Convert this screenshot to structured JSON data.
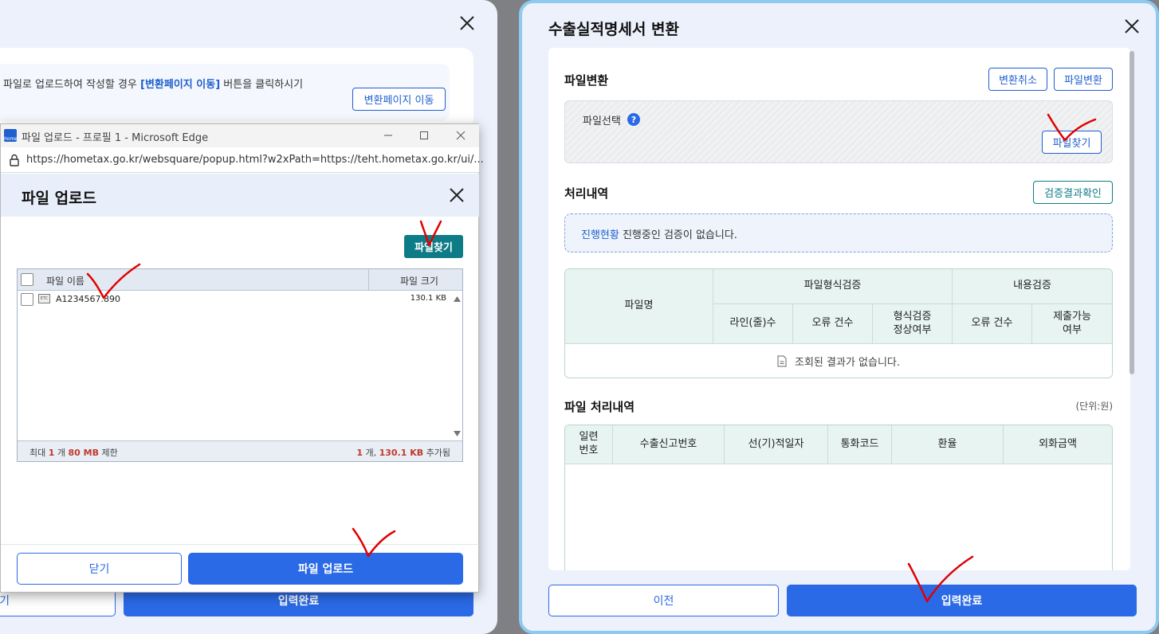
{
  "left_modal": {
    "info_text_prefix": "파일로 업로드하여 작성할 경우 ",
    "info_text_link": "[변환페이지 이동]",
    "info_text_suffix": " 버튼을 클릭하시기",
    "move_button": "변환페이지 이동",
    "prev_button": "기",
    "done_button": "입력완료"
  },
  "edge_window": {
    "title": "파일 업로드 - 프로필 1 - Microsoft Edge",
    "favicon_text": "Home",
    "url": "https://hometax.go.kr/websquare/popup.html?w2xPath=https://teht.hometax.go.kr/ui/..."
  },
  "upload_popup": {
    "title": "파일 업로드",
    "find_button": "파일찾기",
    "table": {
      "col_name": "파일 이름",
      "col_size": "파일 크기",
      "rows": [
        {
          "icon_label": "ETC",
          "name": "A1234567.890",
          "size": "130.1 KB"
        }
      ]
    },
    "footer": {
      "limit_prefix": "최대 ",
      "limit_count": "1",
      "limit_mid": " 개 ",
      "limit_size": "80 MB",
      "limit_suffix": " 제한",
      "added_count": "1",
      "added_mid": " 개, ",
      "added_size": "130.1 KB",
      "added_suffix": " 추가됨"
    },
    "close_button": "닫기",
    "upload_button": "파일 업로드"
  },
  "right_modal": {
    "title": "수출실적명세서 변환",
    "file_convert": {
      "section_title": "파일변환",
      "cancel_button": "변환취소",
      "convert_button": "파일변환",
      "file_select_label": "파일선택",
      "help_icon_text": "?",
      "find_button": "파일찾기"
    },
    "process": {
      "section_title": "처리내역",
      "verify_button": "검증결과확인",
      "progress_label": "진행현황",
      "progress_text": " 진행중인 검증이 없습니다."
    },
    "validation_table": {
      "col_filename": "파일명",
      "group_format": "파일형식검증",
      "group_content": "내용검증",
      "col_lines": "라인(줄)수",
      "col_format_errors": "오류 건수",
      "col_format_ok": "형식검증\n정상여부",
      "col_content_errors": "오류 건수",
      "col_submittable": "제출가능\n여부",
      "empty_message": "조회된 결과가 없습니다."
    },
    "file_history": {
      "section_title": "파일 처리내역",
      "unit": "(단위:원)",
      "columns": [
        "일련\n번호",
        "수출신고번호",
        "선(기)적일자",
        "통화코드",
        "환율",
        "외화금액"
      ]
    },
    "prev_button": "이전",
    "done_button": "입력완료"
  },
  "colors": {
    "primary": "#2a6ae6",
    "teal": "#0e7c86",
    "grid_header": "#e7f4f1",
    "annotation": "#e00000"
  }
}
